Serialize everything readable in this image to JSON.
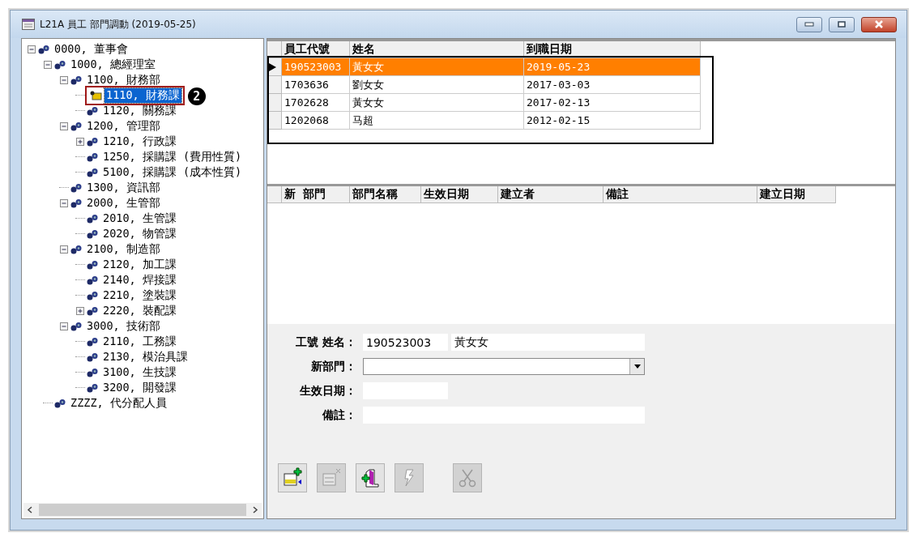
{
  "window": {
    "title": "L21A 員工 部門調動 (2019-05-25)"
  },
  "tree": [
    {
      "label": "0000, 董事會",
      "selected": false,
      "expanded": true,
      "children": [
        {
          "label": "1000, 總經理室",
          "selected": false,
          "expanded": true,
          "children": [
            {
              "label": "1100, 財務部",
              "selected": false,
              "expanded": true,
              "children": [
                {
                  "label": "1110, 財務課",
                  "selected": true
                },
                {
                  "label": "1120, 關務課",
                  "selected": false
                }
              ]
            },
            {
              "label": "1200, 管理部",
              "selected": false,
              "expanded": true,
              "children": [
                {
                  "label": "1210, 行政課",
                  "selected": false,
                  "expanded": false
                },
                {
                  "label": "1250, 採購課 (費用性質)",
                  "selected": false
                },
                {
                  "label": "5100, 採購課 (成本性質)",
                  "selected": false
                }
              ]
            },
            {
              "label": "1300, 資訊部",
              "selected": false
            },
            {
              "label": "2000, 生管部",
              "selected": false,
              "expanded": true,
              "children": [
                {
                  "label": "2010, 生管課",
                  "selected": false
                },
                {
                  "label": "2020, 物管課",
                  "selected": false
                }
              ]
            },
            {
              "label": "2100, 制造部",
              "selected": false,
              "expanded": true,
              "children": [
                {
                  "label": "2120, 加工課",
                  "selected": false
                },
                {
                  "label": "2140, 焊接課",
                  "selected": false
                },
                {
                  "label": "2210, 塗裝課",
                  "selected": false
                },
                {
                  "label": "2220, 裝配課",
                  "selected": false,
                  "expanded": false
                }
              ]
            },
            {
              "label": "3000, 技術部",
              "selected": false,
              "expanded": true,
              "children": [
                {
                  "label": "2110, 工務課",
                  "selected": false
                },
                {
                  "label": "2130, 模治具課",
                  "selected": false
                },
                {
                  "label": "3100, 生技課",
                  "selected": false
                },
                {
                  "label": "3200, 開發課",
                  "selected": false
                }
              ]
            }
          ]
        },
        {
          "label": "ZZZZ, 代分配人員",
          "selected": false
        }
      ]
    }
  ],
  "callout": {
    "label": "2"
  },
  "employees": {
    "columns": [
      "員工代號",
      "姓名",
      "到職日期"
    ],
    "rows": [
      {
        "cells": [
          "190523003",
          "黃女女",
          "2019-05-23"
        ],
        "selected": true
      },
      {
        "cells": [
          "1703636",
          "劉女女",
          "2017-03-03"
        ],
        "selected": false
      },
      {
        "cells": [
          "1702628",
          "黃女女",
          "2017-02-13"
        ],
        "selected": false
      },
      {
        "cells": [
          "1202068",
          "马超",
          "2012-02-15"
        ],
        "selected": false
      }
    ]
  },
  "transfers": {
    "columns": [
      "新  部門",
      "部門名稱",
      "生效日期",
      "建立者",
      "備註",
      "建立日期"
    ]
  },
  "form": {
    "id_name_label": "工號 姓名：",
    "employee_id": "190523003",
    "employee_name": "黃女女",
    "new_dept_label": "新部門：",
    "effective_date_label": "生效日期：",
    "note_label": "備註："
  },
  "toolbar": [
    {
      "kind": "add",
      "disabled": false
    },
    {
      "kind": "delete",
      "disabled": true
    },
    {
      "kind": "exit",
      "disabled": false
    },
    {
      "kind": "flash",
      "disabled": true
    },
    {
      "kind": "cut",
      "disabled": true
    }
  ]
}
